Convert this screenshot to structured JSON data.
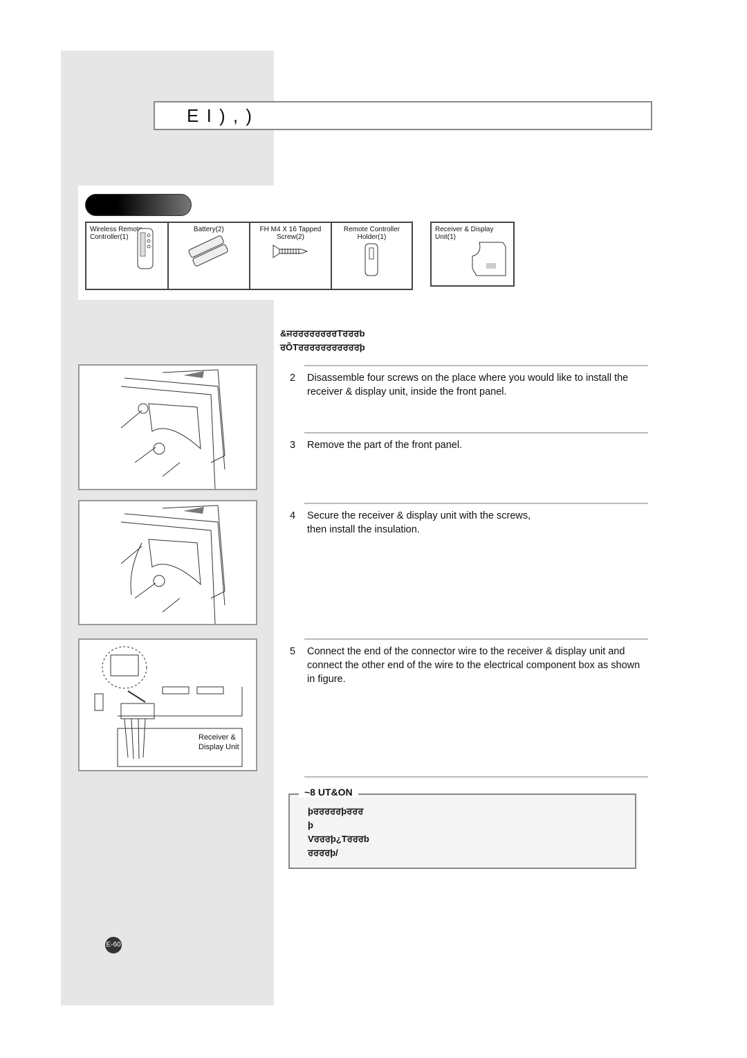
{
  "header": {
    "title": "E I ) ,            )"
  },
  "accessories": [
    {
      "label": "Wireless Remote Controller(1)",
      "icon": "remote-controller-icon"
    },
    {
      "label": "Battery(2)",
      "icon": "battery-icon"
    },
    {
      "label": "FH M4 X 16 Tapped Screw(2)",
      "icon": "screw-icon"
    },
    {
      "label": "Remote Controller Holder(1)",
      "icon": "holder-icon"
    },
    {
      "label": "Receiver & Display Unit(1)",
      "icon": "receiver-display-unit-icon"
    }
  ],
  "intro": {
    "line1": "&ਜਰਰਰਰਰਰਰਰTਰਰਰb",
    "line2": "ਰÕTਰਰਰਰਰਰਰਰਰਰਰþ"
  },
  "steps": [
    {
      "n": "2",
      "text": "Disassemble four screws on the place where you would like to install the receiver & display unit, inside the front panel."
    },
    {
      "n": "3",
      "text": "Remove the part of the front panel."
    },
    {
      "n": "4",
      "text": "Secure the receiver & display unit with the screws, then install the insulation."
    },
    {
      "n": "5",
      "text": "Connect the end of the connector wire to the receiver & display unit and connect the other end of the wire to the electrical component box as shown in figure."
    }
  ],
  "figure3": {
    "label": "Receiver & Display Unit"
  },
  "caution": {
    "title": "~8 UT&ON",
    "line1": "þਰਰਰਰਰþਰਰਰ",
    "line2": "þ",
    "line3": "Vਰਰਰþ¿Tਰਰਰb",
    "line4": "ਰਰਰਰþ/"
  },
  "page": {
    "number": "E-60"
  }
}
